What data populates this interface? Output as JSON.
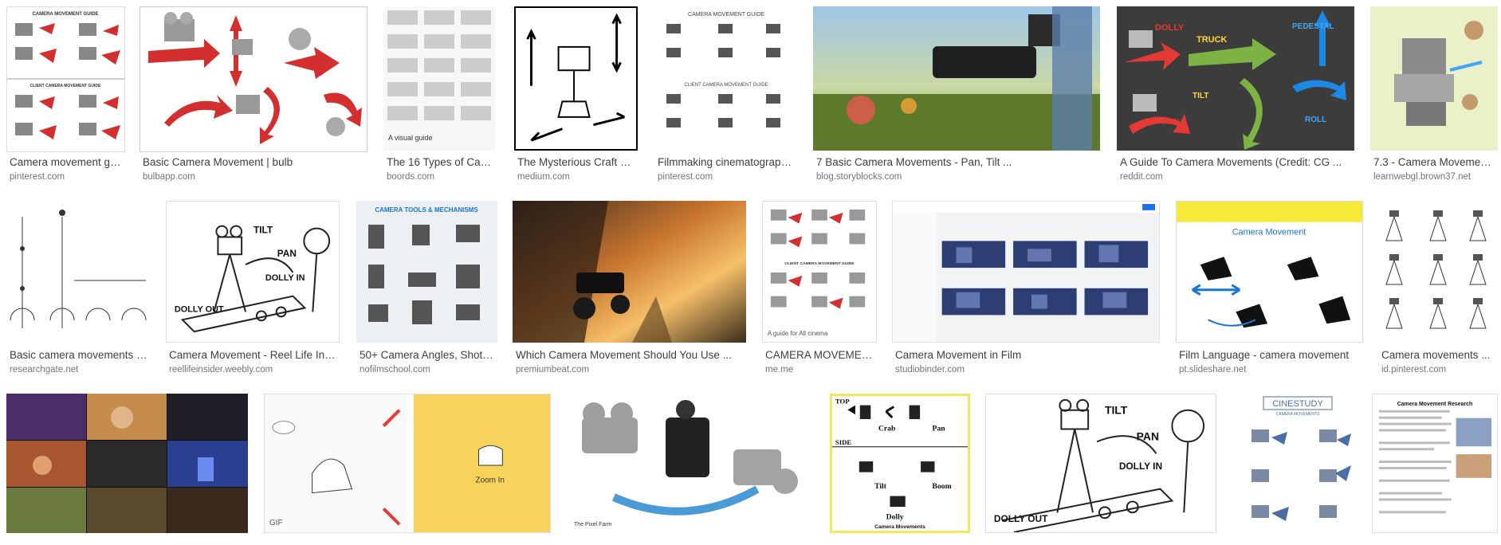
{
  "results": [
    {
      "title": "Camera movement gui...",
      "source": "pinterest.com",
      "palette": "guide-white"
    },
    {
      "title": "Basic Camera Movement | bulb",
      "source": "bulbapp.com",
      "palette": "diagram-red"
    },
    {
      "title": "The 16 Types of Camer...",
      "source": "boords.com",
      "palette": "sheet-gray"
    },
    {
      "title": "The Mysterious Craft of ...",
      "source": "medium.com",
      "palette": "lineart-bw"
    },
    {
      "title": "Filmmaking cinematography ...",
      "source": "pinterest.com",
      "palette": "guide-white"
    },
    {
      "title": "7 Basic Camera Movements - Pan, Tilt ...",
      "source": "blog.storyblocks.com",
      "palette": "photo-green"
    },
    {
      "title": "A Guide To Camera Movements (Credit: CG ...",
      "source": "reddit.com",
      "palette": "dark-color"
    },
    {
      "title": "7.3 - Camera Movement ...",
      "source": "learnwebgl.brown37.net",
      "palette": "yellow-green"
    },
    {
      "title": "Basic camera movements in...",
      "source": "researchgate.net",
      "palette": "lineart-bw"
    },
    {
      "title": "Camera Movement - Reel Life Insider",
      "source": "reellifeinsider.weebly.com",
      "palette": "lineart-bw"
    },
    {
      "title": "50+ Camera Angles, Shots, a...",
      "source": "nofilmschool.com",
      "palette": "gray-blue"
    },
    {
      "title": "Which Camera Movement Should You Use ...",
      "source": "premiumbeat.com",
      "palette": "photo-sunset"
    },
    {
      "title": "CAMERA MOVEMENT ...",
      "source": "me.me",
      "palette": "guide-white"
    },
    {
      "title": "Camera Movement in Film",
      "source": "studiobinder.com",
      "palette": "screen-ui"
    },
    {
      "title": "Film Language - camera movement",
      "source": "pt.slideshare.net",
      "palette": "slide-blue"
    },
    {
      "title": "Camera movements ...",
      "source": "id.pinterest.com",
      "palette": "lineart-bw"
    },
    {
      "title": "",
      "source": "",
      "palette": "film-collage"
    },
    {
      "title": "",
      "source": "",
      "palette": "gif-yellow"
    },
    {
      "title": "",
      "source": "",
      "palette": "render-gray"
    },
    {
      "title": "",
      "source": "",
      "palette": "yellow-border"
    },
    {
      "title": "",
      "source": "",
      "palette": "lineart-bw"
    },
    {
      "title": "",
      "source": "",
      "palette": "cinestudy"
    },
    {
      "title": "",
      "source": "",
      "palette": "research-sheet"
    }
  ],
  "thumb_text": {
    "guide_header": "CAMERA MOVEMENT GUIDE",
    "client_header": "CLIENT CAMERA MOVEMENT GUIDE",
    "label_truck": "TRUCK",
    "label_dolly": "DOLLY",
    "label_tilt": "TILT",
    "label_pan": "PAN",
    "label_pedestal": "PEDESTAL",
    "label_roll": "ROLL",
    "label_crab": "Crab",
    "label_boom": "Boom",
    "label_dolly2": "Dolly",
    "label_tilt2": "Tilt",
    "label_pan2": "Pan",
    "label_top": "TOP",
    "label_side": "SIDE",
    "label_zoom_in": "Zoom In",
    "label_gif": "GIF",
    "label_pixel_farm": "The Pixel Farm",
    "label_tools": "CAMERA TOOLS & MECHANISMS",
    "label_visual_guide": "A visual guide",
    "label_guide_all": "A guide for All cinema",
    "label_cam_movement": "Camera Movement",
    "label_cinestudy": "CINESTUDY",
    "label_cinestudy_sub": "CAMERA MOVEMENTS",
    "label_research": "Camera Movement Research",
    "label_camera_movements": "Camera Movements",
    "label_dolly_in": "DOLLY IN",
    "label_dolly_out": "DOLLY OUT"
  }
}
